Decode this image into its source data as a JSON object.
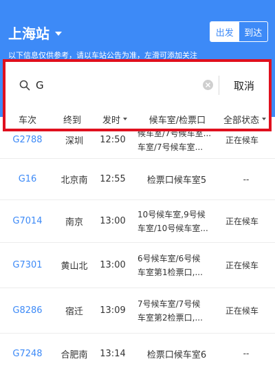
{
  "header": {
    "station": "上海站",
    "toggle": {
      "depart": "出发",
      "arrive": "到达"
    },
    "notice": "以下信息仅供参考，请以车站公告为准，左滑可添加关注"
  },
  "search": {
    "value": "G",
    "cancel_label": "取消"
  },
  "columns": {
    "train": "车次",
    "terminus": "终到",
    "depart_time": "发时",
    "waiting_room": "候车室/检票口",
    "status": "全部状态"
  },
  "rows": [
    {
      "train": "G2788",
      "terminus": "深圳",
      "time": "12:50",
      "waiting": "候车室/7号候车室...",
      "waiting2": "车室/7号候车室...",
      "status": "正在候车"
    },
    {
      "train": "G16",
      "terminus": "北京南",
      "time": "12:55",
      "waiting": "检票口候车室5",
      "waiting2": "",
      "status": "--"
    },
    {
      "train": "G7014",
      "terminus": "南京",
      "time": "13:00",
      "waiting": "10号候车室,9号候",
      "waiting2": "车室/10号候车室...",
      "status": "正在候车"
    },
    {
      "train": "G7301",
      "terminus": "黄山北",
      "time": "13:00",
      "waiting": "6号候车室/6号候",
      "waiting2": "车室第1检票口,...",
      "status": "正在候车"
    },
    {
      "train": "G8286",
      "terminus": "宿迁",
      "time": "13:09",
      "waiting": "7号候车室/7号候",
      "waiting2": "车室第2检票口,...",
      "status": "正在候车"
    },
    {
      "train": "G7248",
      "terminus": "合肥南",
      "time": "13:14",
      "waiting": "检票口候车室6",
      "waiting2": "",
      "status": "--"
    }
  ],
  "colors": {
    "brand": "#3d8af7",
    "highlight": "#e0101e"
  }
}
